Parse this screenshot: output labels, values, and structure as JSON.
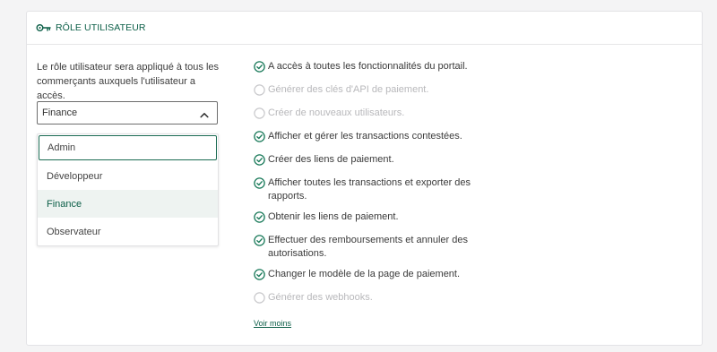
{
  "header": {
    "title": "RÔLE UTILISATEUR",
    "icon": "key-icon"
  },
  "description": "Le rôle utilisateur sera appliqué à tous les commerçants auxquels l'utilisateur a accès.",
  "role_select": {
    "value": "Finance",
    "icon": "chevron-up-icon"
  },
  "dropdown": {
    "options": [
      "Admin",
      "Développeur",
      "Finance",
      "Observateur"
    ],
    "focused": "Admin",
    "selected": "Finance"
  },
  "permissions": [
    {
      "label": "A accès à toutes les fonctionnalités du portail.",
      "enabled": true
    },
    {
      "label": "Générer des clés d'API de paiement.",
      "enabled": false
    },
    {
      "label": "Créer de nouveaux utilisateurs.",
      "enabled": false
    },
    {
      "label": "Afficher et gérer les transactions contestées.",
      "enabled": true
    },
    {
      "label": "Créer des liens de paiement.",
      "enabled": true
    },
    {
      "label": "Afficher toutes les transactions et exporter des rapports.",
      "enabled": true
    },
    {
      "label": "Obtenir les liens de paiement.",
      "enabled": true
    },
    {
      "label": "Effectuer des remboursements et annuler des autorisations.",
      "enabled": true
    },
    {
      "label": "Changer le modèle de la page de paiement.",
      "enabled": true
    },
    {
      "label": "Générer des webhooks.",
      "enabled": false
    }
  ],
  "see_less_link": "Voir moins",
  "colors": {
    "accent": "#0b5e47",
    "check": "#1a7a5a",
    "disabled": "#c8c8cb"
  }
}
